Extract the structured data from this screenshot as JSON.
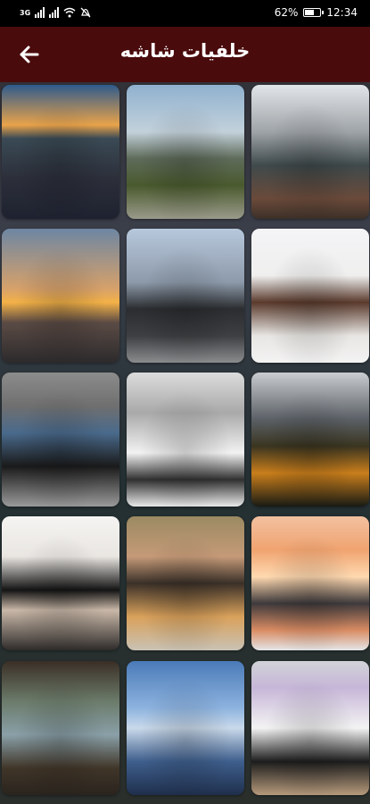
{
  "status_bar": {
    "network": "3G",
    "battery_percent": "62%",
    "battery_level": 0.62,
    "time": "12:34",
    "icons": [
      "signal-icon",
      "wifi-icon",
      "mute-icon",
      "battery-icon"
    ]
  },
  "app_bar": {
    "title": "خلفيات شاشه",
    "back_icon": "arrow-back-icon"
  },
  "wallpapers": [
    {
      "name": "wallpaper-mountain-sunset",
      "subject": "mountain sunset"
    },
    {
      "name": "wallpaper-rocky-peaks-road",
      "subject": "rocky peaks road"
    },
    {
      "name": "wallpaper-woman-on-rocks",
      "subject": "woman on rocks"
    },
    {
      "name": "wallpaper-sea-sunset",
      "subject": "sea sunset"
    },
    {
      "name": "wallpaper-electric-scooter",
      "subject": "electric scooter"
    },
    {
      "name": "wallpaper-woman-flower-crown",
      "subject": "woman with flower crown"
    },
    {
      "name": "wallpaper-woman-denim-jacket",
      "subject": "woman in denim jacket"
    },
    {
      "name": "wallpaper-bicycle-in-snow",
      "subject": "bicycle in snow"
    },
    {
      "name": "wallpaper-autumn-mountain-lake",
      "subject": "autumn mountain lake"
    },
    {
      "name": "wallpaper-woman-black-hat",
      "subject": "woman in black hat"
    },
    {
      "name": "wallpaper-two-women-lying",
      "subject": "two women lying"
    },
    {
      "name": "wallpaper-stacked-donuts",
      "subject": "stacked donuts"
    },
    {
      "name": "wallpaper-wooden-frame-coast",
      "subject": "wooden frame coast"
    },
    {
      "name": "wallpaper-city-skyline",
      "subject": "city skyline"
    },
    {
      "name": "wallpaper-girl-pink-hair",
      "subject": "girl with pink hair"
    }
  ]
}
